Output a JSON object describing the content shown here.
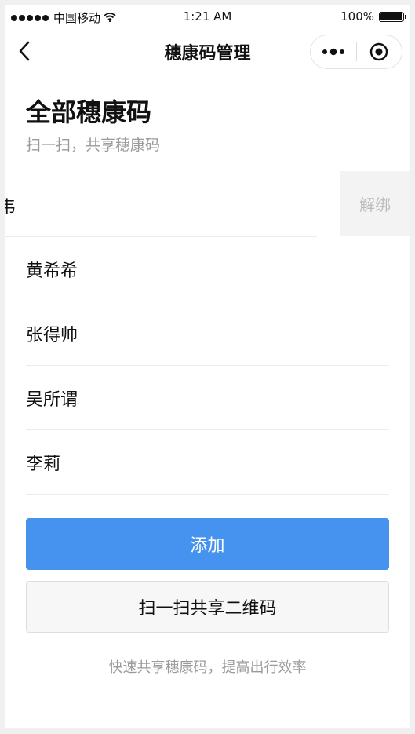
{
  "status_bar": {
    "carrier": "中国移动",
    "time": "1:21 AM",
    "battery_text": "100%",
    "battery_level": 1.0,
    "signal_icon": "signal-dots-icon",
    "wifi_icon": "wifi-icon"
  },
  "nav": {
    "title": "穗康码管理",
    "back_icon": "chevron-left-icon",
    "more_icon": "more-dots-icon",
    "close_icon": "target-close-icon"
  },
  "header": {
    "title": "全部穗康码",
    "subtitle": "扫一扫，共享穗康码"
  },
  "swiped_row": {
    "name_fragment": "韦",
    "unbind_label": "解绑"
  },
  "list": {
    "items": [
      {
        "name": "黄希希"
      },
      {
        "name": "张得帅"
      },
      {
        "name": "吴所谓"
      },
      {
        "name": "李莉"
      }
    ]
  },
  "actions": {
    "add_label": "添加",
    "scan_label": "扫一扫共享二维码"
  },
  "footnote": "快速共享穗康码，提高出行效率",
  "colors": {
    "primary": "#4593ef",
    "muted_text": "#9a9a9a",
    "unbind_bg": "#f3f3f3"
  }
}
